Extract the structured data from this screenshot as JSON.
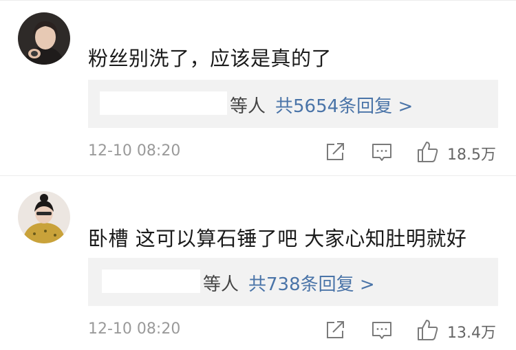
{
  "comments": [
    {
      "text": "粉丝别洗了，应该是真的了",
      "replies": {
        "others": "等人",
        "count_label": "共5654条回复 >"
      },
      "time": "12-10 08:20",
      "likes": "18.5万"
    },
    {
      "text": "卧槽 这可以算石锤了吧 大家心知肚明就好",
      "replies": {
        "others": "等人",
        "count_label": "共738条回复 >"
      },
      "time": "12-10 08:20",
      "likes": "13.4万"
    }
  ],
  "colors": {
    "link_blue": "#4a74a8",
    "reply_bg": "#f2f2f2",
    "meta_gray": "#9a9a9a"
  },
  "icons": [
    "share-icon",
    "comment-icon",
    "like-icon"
  ]
}
